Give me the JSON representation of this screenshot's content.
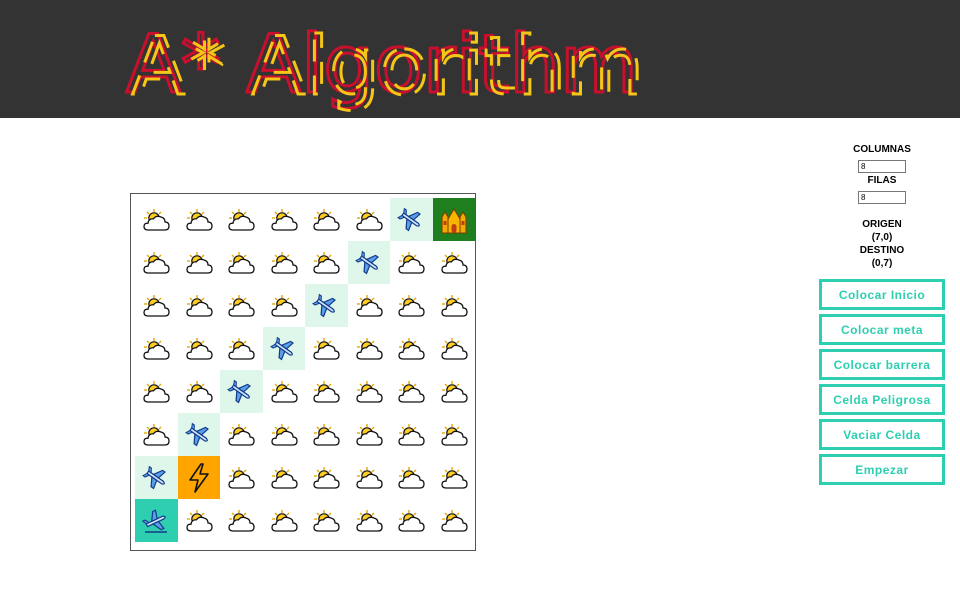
{
  "header": {
    "title": "A* Algorithm"
  },
  "colors": {
    "header_bg": "#333333",
    "title_red": "#c8102e",
    "title_yellow": "#f5c518",
    "accent": "#2ecfb0",
    "goal": "#1f7f1f",
    "danger": "#ffa500",
    "path": "#dff7eb"
  },
  "settings": {
    "columns_label": "COLUMNAS",
    "columns_value": "8",
    "rows_label": "FILAS",
    "rows_value": "8",
    "origin_label": "ORIGEN",
    "origin_value": "(7,0)",
    "destination_label": "DESTINO",
    "destination_value": "(0,7)"
  },
  "buttons": {
    "place_start": "Colocar Inicio",
    "place_goal": "Colocar meta",
    "place_barrier": "Colocar barrera",
    "danger_cell": "Celda Peligrosa",
    "clear_cell": "Vaciar Celda",
    "start": "Empezar"
  },
  "grid": {
    "cols": 8,
    "rows": 8,
    "cells": [
      [
        "cloud",
        "cloud",
        "cloud",
        "cloud",
        "cloud",
        "cloud",
        "path",
        "goal"
      ],
      [
        "cloud",
        "cloud",
        "cloud",
        "cloud",
        "cloud",
        "path",
        "cloud",
        "cloud"
      ],
      [
        "cloud",
        "cloud",
        "cloud",
        "cloud",
        "path",
        "cloud",
        "cloud",
        "cloud"
      ],
      [
        "cloud",
        "cloud",
        "cloud",
        "path",
        "cloud",
        "cloud",
        "cloud",
        "cloud"
      ],
      [
        "cloud",
        "cloud",
        "path",
        "cloud",
        "cloud",
        "cloud",
        "cloud",
        "cloud"
      ],
      [
        "cloud",
        "path",
        "cloud",
        "cloud",
        "cloud",
        "cloud",
        "cloud",
        "cloud"
      ],
      [
        "path",
        "danger",
        "cloud",
        "cloud",
        "cloud",
        "cloud",
        "cloud",
        "cloud"
      ],
      [
        "start",
        "cloud",
        "cloud",
        "cloud",
        "cloud",
        "cloud",
        "cloud",
        "cloud"
      ]
    ]
  },
  "icons": {
    "cloud": "sun-behind-cloud-icon",
    "path": "airplane-icon",
    "start": "airplane-departure-icon",
    "goal": "castle-icon",
    "danger": "lightning-icon"
  }
}
